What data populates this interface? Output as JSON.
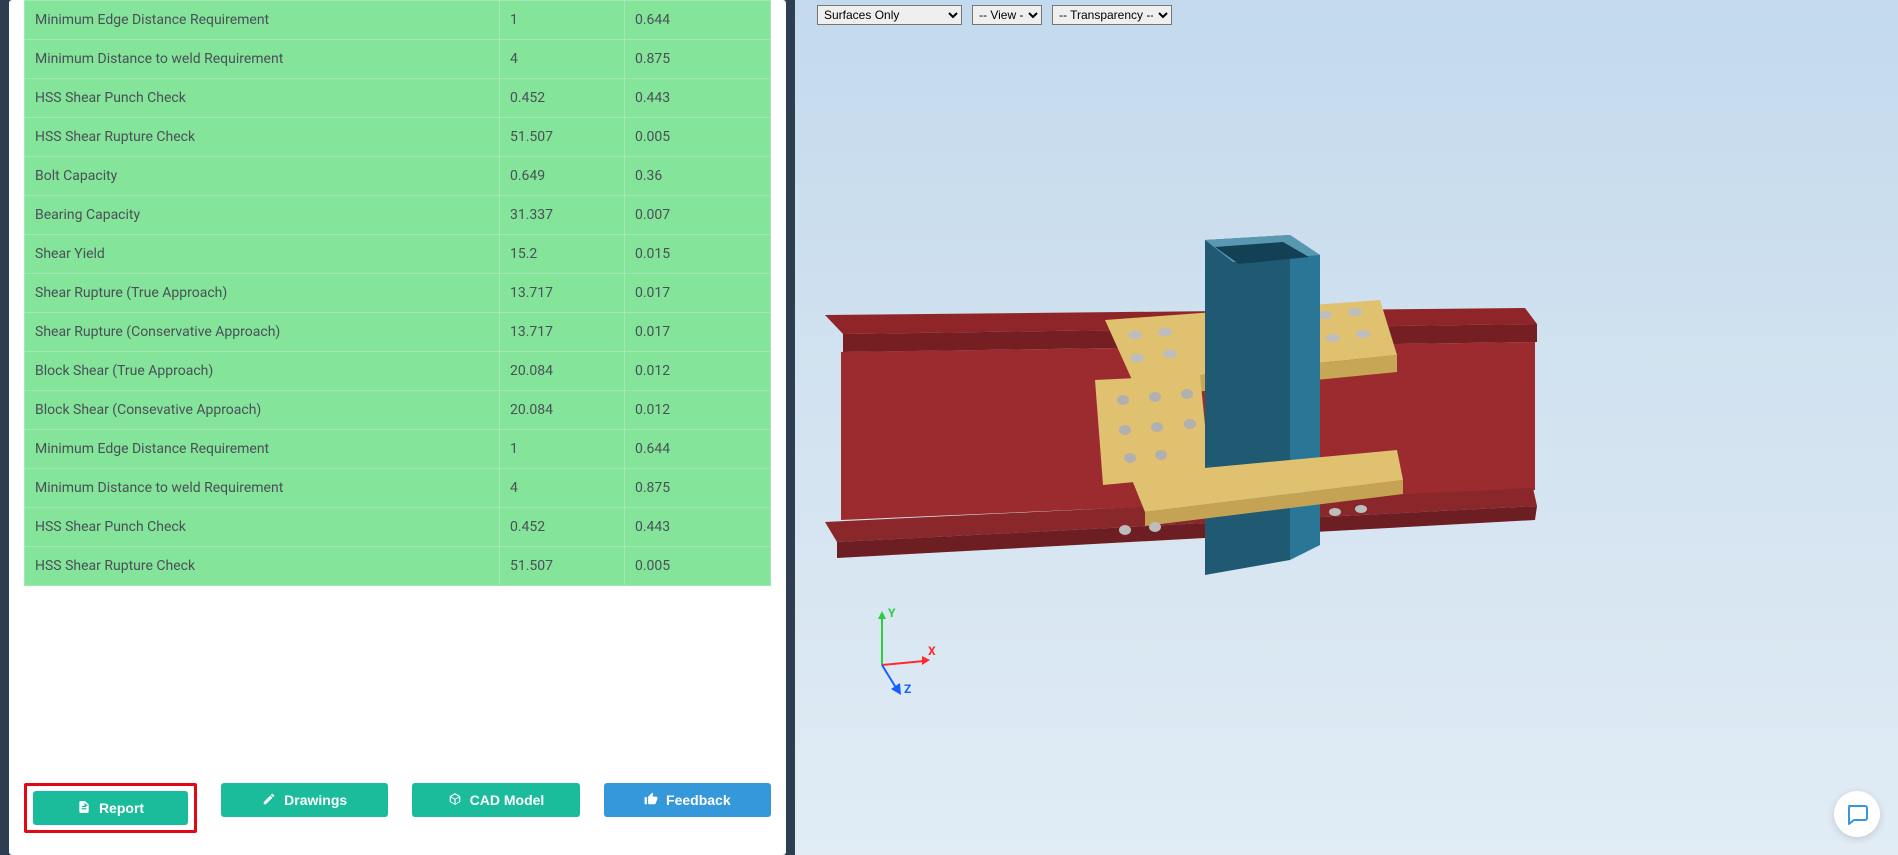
{
  "table": {
    "rows": [
      {
        "name": "Minimum Edge Distance Requirement",
        "v1": "1",
        "v2": "0.644"
      },
      {
        "name": "Minimum Distance to weld Requirement",
        "v1": "4",
        "v2": "0.875"
      },
      {
        "name": "HSS Shear Punch Check",
        "v1": "0.452",
        "v2": "0.443"
      },
      {
        "name": "HSS Shear Rupture Check",
        "v1": "51.507",
        "v2": "0.005"
      },
      {
        "name": "Bolt Capacity",
        "v1": "0.649",
        "v2": "0.36"
      },
      {
        "name": "Bearing Capacity",
        "v1": "31.337",
        "v2": "0.007"
      },
      {
        "name": "Shear Yield",
        "v1": "15.2",
        "v2": "0.015"
      },
      {
        "name": "Shear Rupture (True Approach)",
        "v1": "13.717",
        "v2": "0.017"
      },
      {
        "name": "Shear Rupture (Conservative Approach)",
        "v1": "13.717",
        "v2": "0.017"
      },
      {
        "name": "Block Shear (True Approach)",
        "v1": "20.084",
        "v2": "0.012"
      },
      {
        "name": "Block Shear (Consevative Approach)",
        "v1": "20.084",
        "v2": "0.012"
      },
      {
        "name": "Minimum Edge Distance Requirement",
        "v1": "1",
        "v2": "0.644"
      },
      {
        "name": "Minimum Distance to weld Requirement",
        "v1": "4",
        "v2": "0.875"
      },
      {
        "name": "HSS Shear Punch Check",
        "v1": "0.452",
        "v2": "0.443"
      },
      {
        "name": "HSS Shear Rupture Check",
        "v1": "51.507",
        "v2": "0.005"
      }
    ]
  },
  "buttons": {
    "report": "Report",
    "drawings": "Drawings",
    "cad_model": "CAD Model",
    "feedback": "Feedback"
  },
  "viewer": {
    "select_display": "Surfaces Only",
    "select_view": "-- View --",
    "select_transparency": "-- Transparency --",
    "axis": {
      "x": "X",
      "y": "Y",
      "z": "Z"
    }
  },
  "colors": {
    "row_bg": "#84e49a",
    "btn_teal": "#1abc9c",
    "btn_blue": "#3498db",
    "highlight": "#e30613",
    "beam": "#9b2b2e",
    "column": "#266a87",
    "plate": "#e0c16f",
    "bolt": "#bdbdbd"
  }
}
